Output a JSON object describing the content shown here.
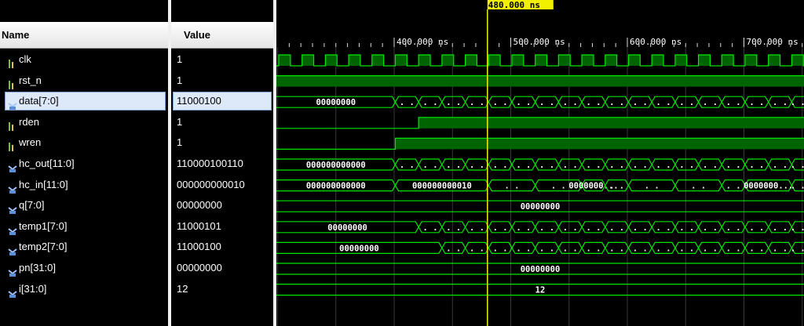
{
  "columns": {
    "name": "Name",
    "value": "Value"
  },
  "cursor": {
    "label": "480.000 ns",
    "time_ns": 480
  },
  "timeline": {
    "ticks": [
      {
        "t": 400,
        "label": "400.000 ns"
      },
      {
        "t": 500,
        "label": "500.000 ns"
      },
      {
        "t": 600,
        "label": "600.000 ns"
      },
      {
        "t": 700,
        "label": "700.000 ns"
      }
    ]
  },
  "signals": [
    {
      "name": "clk",
      "value": "1",
      "type": "bit"
    },
    {
      "name": "rst_n",
      "value": "1",
      "type": "bit"
    },
    {
      "name": "data[7:0]",
      "value": "11000100",
      "type": "bus",
      "selected": true,
      "first_label": "00000000"
    },
    {
      "name": "rden",
      "value": "1",
      "type": "bit"
    },
    {
      "name": "wren",
      "value": "1",
      "type": "bit"
    },
    {
      "name": "hc_out[11:0]",
      "value": "110000100110",
      "type": "bus",
      "first_label": "000000000000"
    },
    {
      "name": "hc_in[11:0]",
      "value": "000000000010",
      "type": "bus",
      "first_label": "000000000000",
      "segment_labels": [
        "000000000010",
        "0000000...",
        "0000000..."
      ]
    },
    {
      "name": "q[7:0]",
      "value": "00000000",
      "type": "bus",
      "first_label": "00000000"
    },
    {
      "name": "temp1[7:0]",
      "value": "11000101",
      "type": "bus",
      "first_label": "00000000"
    },
    {
      "name": "temp2[7:0]",
      "value": "11000100",
      "type": "bus",
      "first_label": "00000000"
    },
    {
      "name": "pn[31:0]",
      "value": "00000000",
      "type": "bus",
      "first_label": "00000000"
    },
    {
      "name": "i[31:0]",
      "value": "12",
      "type": "bus",
      "first_label": "12"
    }
  ],
  "colors": {
    "wave": "#00e600",
    "fill": "#006400",
    "cursor": "#f0f000",
    "grid": "#3a3a3a",
    "selection": "#dde9f8"
  }
}
